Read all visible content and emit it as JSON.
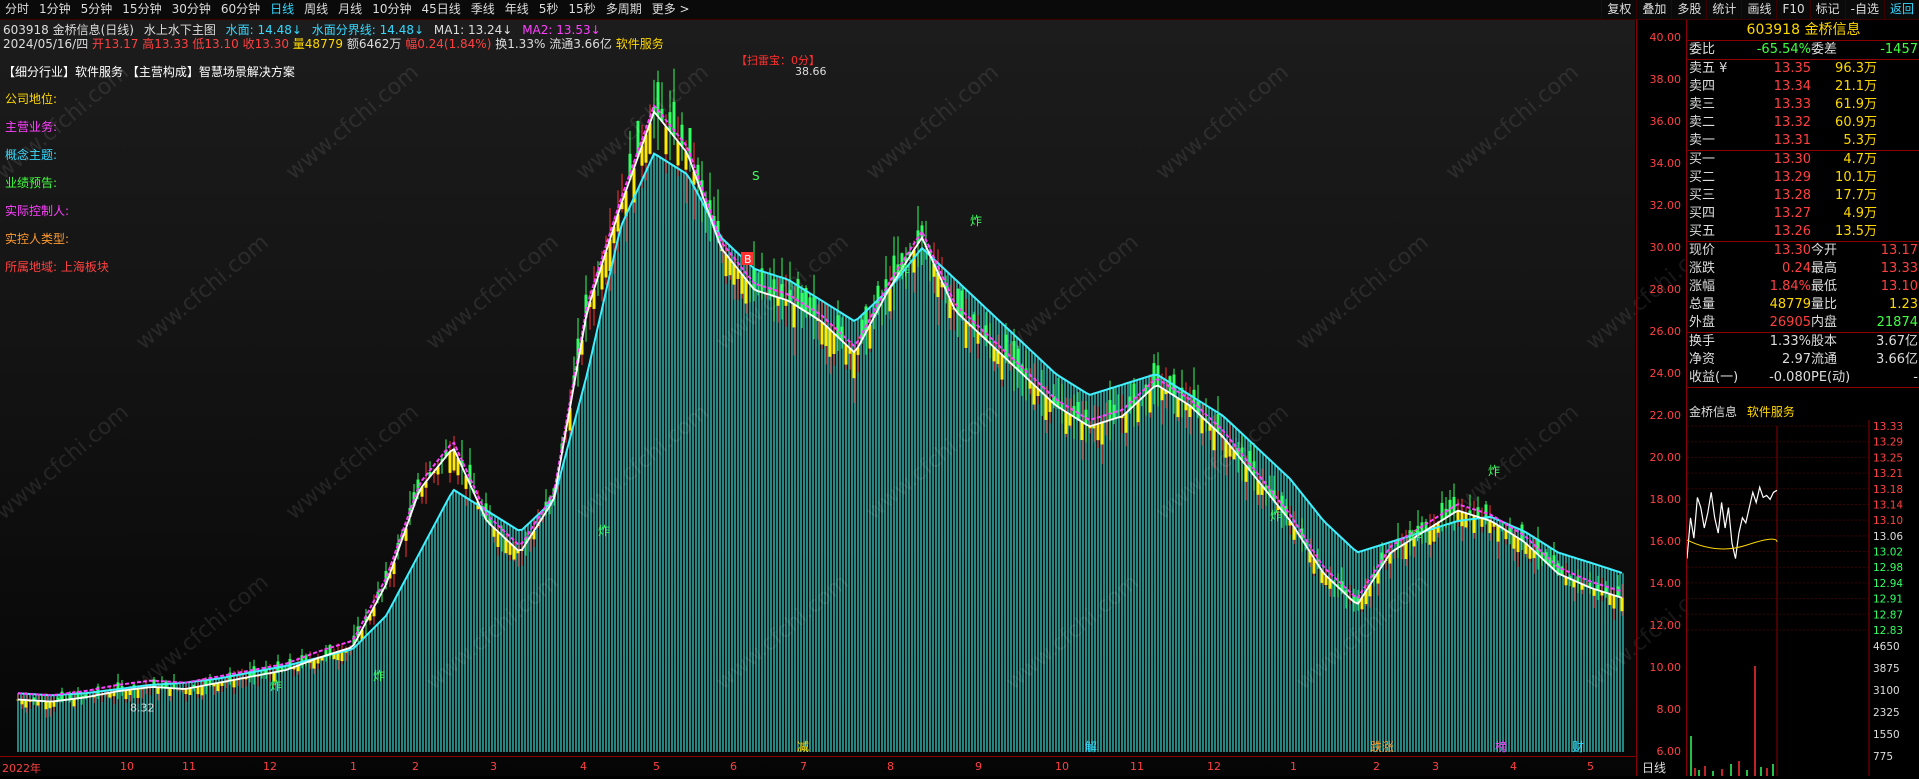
{
  "toolbar": {
    "left_items": [
      "分时",
      "1分钟",
      "5分钟",
      "15分钟",
      "30分钟",
      "60分钟",
      "日线",
      "周线",
      "月线",
      "10分钟",
      "45日线",
      "季线",
      "年线",
      "5秒",
      "15秒",
      "多周期",
      "更多 >"
    ],
    "active_index": 6,
    "right_items": [
      "复权",
      "叠加",
      "多股",
      "统计",
      "画线",
      "F10",
      "标记",
      "-自选",
      "返回"
    ]
  },
  "info_line1": {
    "code_name": "603918 金桥信息(日线)",
    "indicator": "水上水下主图",
    "shuimian": "水面: 14.48↓",
    "shuimian_line": "水面分界线: 14.48↓",
    "ma1": "MA1: 13.24↓",
    "ma2": "MA2: 13.53↓"
  },
  "info_line2": {
    "date": "2024/05/16/四",
    "open": "开13.17",
    "high": "高13.33",
    "low": "低13.10",
    "close": "收13.30",
    "vol": "量48779",
    "amount": "额6462万",
    "change": "幅0.24(1.84%)",
    "turnover": "换1.33%",
    "float": "流通3.66亿",
    "sector": "软件服务"
  },
  "sector_line": "【细分行业】软件服务 【主营构成】智慧场景解决方案",
  "labels": [
    {
      "text": "公司地位:",
      "color": "#ffd800"
    },
    {
      "text": "主营业务:",
      "color": "#ff40ff"
    },
    {
      "text": "概念主题:",
      "color": "#35d8ff"
    },
    {
      "text": "业绩预告:",
      "color": "#40ff40"
    },
    {
      "text": "实际控制人:",
      "color": "#ff40ff"
    },
    {
      "text": "实控人类型:",
      "color": "#ff9a2e"
    },
    {
      "text": "所属地域: 上海板块",
      "color": "#ff4040"
    }
  ],
  "watermark": "www.cfchi.com",
  "annotations": {
    "high_label": "38.66",
    "low_label": "8.32",
    "flag": "【扫雷宝：0分】",
    "zha": "炸",
    "s": "S",
    "b": "B"
  },
  "bottom_events": [
    "减",
    "解",
    "跌涨",
    "榜",
    "财"
  ],
  "price_axis": [
    "40.00",
    "38.00",
    "36.00",
    "34.00",
    "32.00",
    "30.00",
    "28.00",
    "26.00",
    "24.00",
    "22.00",
    "20.00",
    "18.00",
    "16.00",
    "14.00",
    "12.00",
    "10.00",
    "8.00",
    "6.00"
  ],
  "time_axis": [
    "2022年",
    "10",
    "11",
    "12",
    "1",
    "2",
    "3",
    "4",
    "5",
    "6",
    "7",
    "8",
    "9",
    "10",
    "11",
    "12",
    "1",
    "2",
    "3",
    "4",
    "5"
  ],
  "period_label": "日线",
  "quote": {
    "title": "603918 金桥信息",
    "ratio": {
      "label": "委比",
      "value": "-65.54%",
      "label2": "委差",
      "value2": "-1457"
    },
    "asks": [
      {
        "label": "卖五 ¥",
        "price": "13.35",
        "vol": "96.3万"
      },
      {
        "label": "卖四",
        "price": "13.34",
        "vol": "21.1万"
      },
      {
        "label": "卖三",
        "price": "13.33",
        "vol": "61.9万"
      },
      {
        "label": "卖二",
        "price": "13.32",
        "vol": "60.9万"
      },
      {
        "label": "卖一",
        "price": "13.31",
        "vol": "5.3万"
      }
    ],
    "bids": [
      {
        "label": "买一",
        "price": "13.30",
        "vol": "4.7万"
      },
      {
        "label": "买二",
        "price": "13.29",
        "vol": "10.1万"
      },
      {
        "label": "买三",
        "price": "13.28",
        "vol": "17.7万"
      },
      {
        "label": "买四",
        "price": "13.27",
        "vol": "4.9万"
      },
      {
        "label": "买五",
        "price": "13.26",
        "vol": "13.5万"
      }
    ],
    "stats": [
      {
        "l": "现价",
        "v": "13.30",
        "l2": "今开",
        "v2": "13.17"
      },
      {
        "l": "涨跌",
        "v": "0.24",
        "l2": "最高",
        "v2": "13.33"
      },
      {
        "l": "涨幅",
        "v": "1.84%",
        "l2": "最低",
        "v2": "13.10"
      },
      {
        "l": "总量",
        "v": "48779",
        "l2": "量比",
        "v2": "1.23"
      },
      {
        "l": "外盘",
        "v": "26905",
        "l2": "内盘",
        "v2": "21874"
      }
    ],
    "stats2": [
      {
        "l": "换手",
        "v": "1.33%",
        "l2": "股本",
        "v2": "3.67亿"
      },
      {
        "l": "净资",
        "v": "2.97",
        "l2": "流通",
        "v2": "3.66亿"
      },
      {
        "l": "收益(一)",
        "v": "-0.080",
        "l2": "PE(动)",
        "v2": "-"
      }
    ],
    "mini_title": "金桥信息",
    "mini_sector": "软件服务",
    "mini_axis": [
      "13.33",
      "13.29",
      "13.25",
      "13.21",
      "13.18",
      "13.14",
      "13.10",
      "13.06",
      "13.02",
      "12.98",
      "12.94",
      "12.91",
      "12.87",
      "12.83"
    ],
    "mini_vol_axis": [
      "4650",
      "3875",
      "3100",
      "2325",
      "1550",
      "775"
    ]
  },
  "chart_data": {
    "type": "candlestick",
    "title": "603918 金桥信息(日线)",
    "x_range": [
      "2022-09",
      "2024-05-16"
    ],
    "ylim": [
      6,
      40
    ],
    "month_ticks": [
      "2022年",
      "10",
      "11",
      "12",
      "1",
      "2",
      "3",
      "4",
      "5",
      "6",
      "7",
      "8",
      "9",
      "10",
      "11",
      "12",
      "1",
      "2",
      "3",
      "4",
      "5"
    ],
    "close_points": [
      8.5,
      8.4,
      8.6,
      8.9,
      9.1,
      9.0,
      9.3,
      9.6,
      9.9,
      10.5,
      11.0,
      14.0,
      18.5,
      20.5,
      17.0,
      15.5,
      18.0,
      27.0,
      32.0,
      36.5,
      34.5,
      30.0,
      28.0,
      27.5,
      26.5,
      25.0,
      28.0,
      30.5,
      27.0,
      25.5,
      24.0,
      22.5,
      21.5,
      22.0,
      23.5,
      22.5,
      21.0,
      19.0,
      17.0,
      14.5,
      13.0,
      15.5,
      16.5,
      17.5,
      17.0,
      16.0,
      14.5,
      13.8,
      13.3
    ],
    "shuimian_points": [
      8.8,
      8.7,
      8.8,
      9.0,
      9.2,
      9.3,
      9.5,
      9.8,
      10.1,
      10.5,
      10.9,
      12.5,
      15.5,
      18.5,
      17.5,
      16.5,
      18.0,
      24.0,
      31.0,
      34.5,
      33.5,
      30.5,
      29.0,
      28.5,
      27.5,
      26.5,
      28.0,
      30.0,
      28.5,
      27.0,
      25.5,
      24.0,
      23.0,
      23.5,
      24.0,
      23.0,
      22.0,
      20.5,
      19.0,
      17.0,
      15.5,
      16.0,
      16.5,
      17.0,
      17.2,
      16.5,
      15.5,
      15.0,
      14.48
    ],
    "ma1_last": 13.24,
    "ma2_last": 13.53,
    "high": 38.66,
    "low": 8.32
  }
}
